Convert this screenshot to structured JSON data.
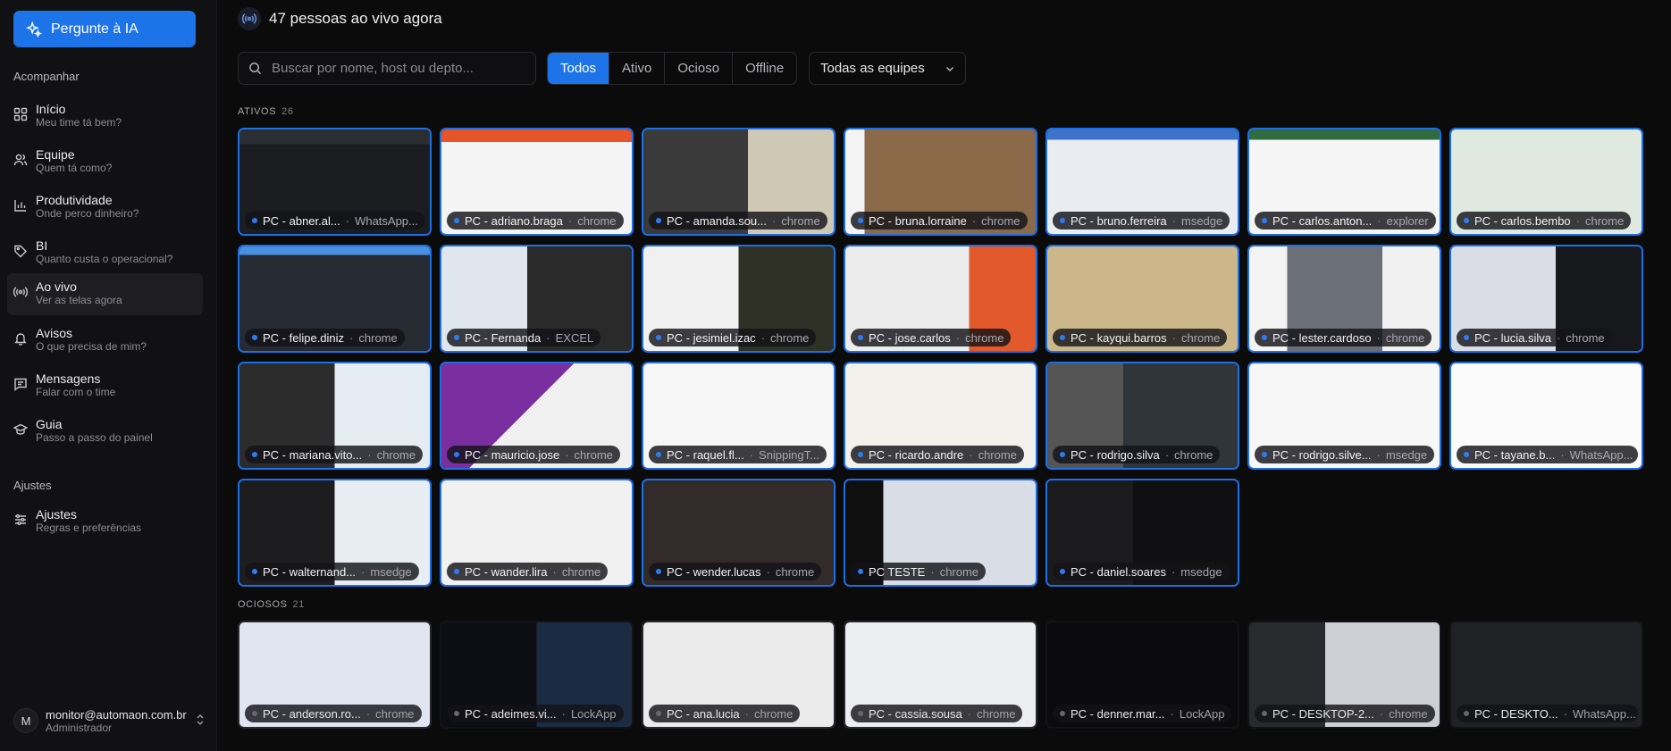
{
  "sidebar": {
    "ask_label": "Pergunte à IA",
    "section_follow": "Acompanhar",
    "section_settings": "Ajustes",
    "items": [
      {
        "label": "Início",
        "sub": "Meu time tá bem?",
        "icon": "grid-icon"
      },
      {
        "label": "Equipe",
        "sub": "Quem tá como?",
        "icon": "team-icon"
      },
      {
        "label": "Produtividade",
        "sub": "Onde perco dinheiro?",
        "icon": "chart-icon"
      },
      {
        "label": "BI",
        "sub": "Quanto custa o operacional?",
        "icon": "tag-icon"
      },
      {
        "label": "Ao vivo",
        "sub": "Ver as telas agora",
        "icon": "broadcast-icon"
      },
      {
        "label": "Avisos",
        "sub": "O que precisa de mim?",
        "icon": "bell-icon"
      },
      {
        "label": "Mensagens",
        "sub": "Falar com o time",
        "icon": "message-icon"
      },
      {
        "label": "Guia",
        "sub": "Passo a passo do painel",
        "icon": "graduation-icon"
      }
    ],
    "settings_item": {
      "label": "Ajustes",
      "sub": "Regras e preferências",
      "icon": "sliders-icon"
    },
    "user": {
      "initial": "M",
      "email": "monitor@automaon.com.br",
      "role": "Administrador"
    }
  },
  "main": {
    "live_title": "47 pessoas ao vivo agora",
    "search_placeholder": "Buscar por nome, host ou depto...",
    "filters": [
      "Todos",
      "Ativo",
      "Ocioso",
      "Offline"
    ],
    "active_filter": "Todos",
    "team_select": "Todas as equipes",
    "groups": {
      "active": {
        "label": "ATIVOS",
        "count": "26"
      },
      "idle": {
        "label": "OCIOSOS",
        "count": "21"
      }
    },
    "active_tiles": [
      {
        "host": "PC - abner.al...",
        "app": "WhatsApp..."
      },
      {
        "host": "PC - adriano.braga",
        "app": "chrome"
      },
      {
        "host": "PC - amanda.sou...",
        "app": "chrome"
      },
      {
        "host": "PC - bruna.lorraine",
        "app": "chrome"
      },
      {
        "host": "PC - bruno.ferreira",
        "app": "msedge"
      },
      {
        "host": "PC - carlos.anton...",
        "app": "explorer"
      },
      {
        "host": "PC - carlos.bembo",
        "app": "chrome"
      },
      {
        "host": "PC - felipe.diniz",
        "app": "chrome"
      },
      {
        "host": "PC - Fernanda",
        "app": "EXCEL"
      },
      {
        "host": "PC - jesimiel.izac",
        "app": "chrome"
      },
      {
        "host": "PC - jose.carlos",
        "app": "chrome"
      },
      {
        "host": "PC - kayqui.barros",
        "app": "chrome"
      },
      {
        "host": "PC - lester.cardoso",
        "app": "chrome"
      },
      {
        "host": "PC - lucia.silva",
        "app": "chrome"
      },
      {
        "host": "PC - mariana.vito...",
        "app": "chrome"
      },
      {
        "host": "PC - mauricio.jose",
        "app": "chrome"
      },
      {
        "host": "PC - raquel.fl...",
        "app": "SnippingT..."
      },
      {
        "host": "PC - ricardo.andre",
        "app": "chrome"
      },
      {
        "host": "PC - rodrigo.silva",
        "app": "chrome"
      },
      {
        "host": "PC - rodrigo.silve...",
        "app": "msedge"
      },
      {
        "host": "PC - tayane.b...",
        "app": "WhatsApp..."
      },
      {
        "host": "PC - walternand...",
        "app": "msedge"
      },
      {
        "host": "PC - wander.lira",
        "app": "chrome"
      },
      {
        "host": "PC - wender.lucas",
        "app": "chrome"
      },
      {
        "host": "PC TESTE",
        "app": "chrome"
      },
      {
        "host": "PC - daniel.soares",
        "app": "msedge"
      }
    ],
    "idle_tiles": [
      {
        "host": "PC - anderson.ro...",
        "app": "chrome"
      },
      {
        "host": "PC - adeimes.vi...",
        "app": "LockApp"
      },
      {
        "host": "PC - ana.lucia",
        "app": "chrome"
      },
      {
        "host": "PC - cassia.sousa",
        "app": "chrome"
      },
      {
        "host": "PC - denner.mar...",
        "app": "LockApp"
      },
      {
        "host": "PC - DESKTOP-2...",
        "app": "chrome"
      },
      {
        "host": "PC - DESKTO...",
        "app": "WhatsApp..."
      }
    ],
    "colors": {
      "accent": "#1d74e8",
      "border_active": "#1d6fe5",
      "background": "#0b0b0c"
    }
  }
}
